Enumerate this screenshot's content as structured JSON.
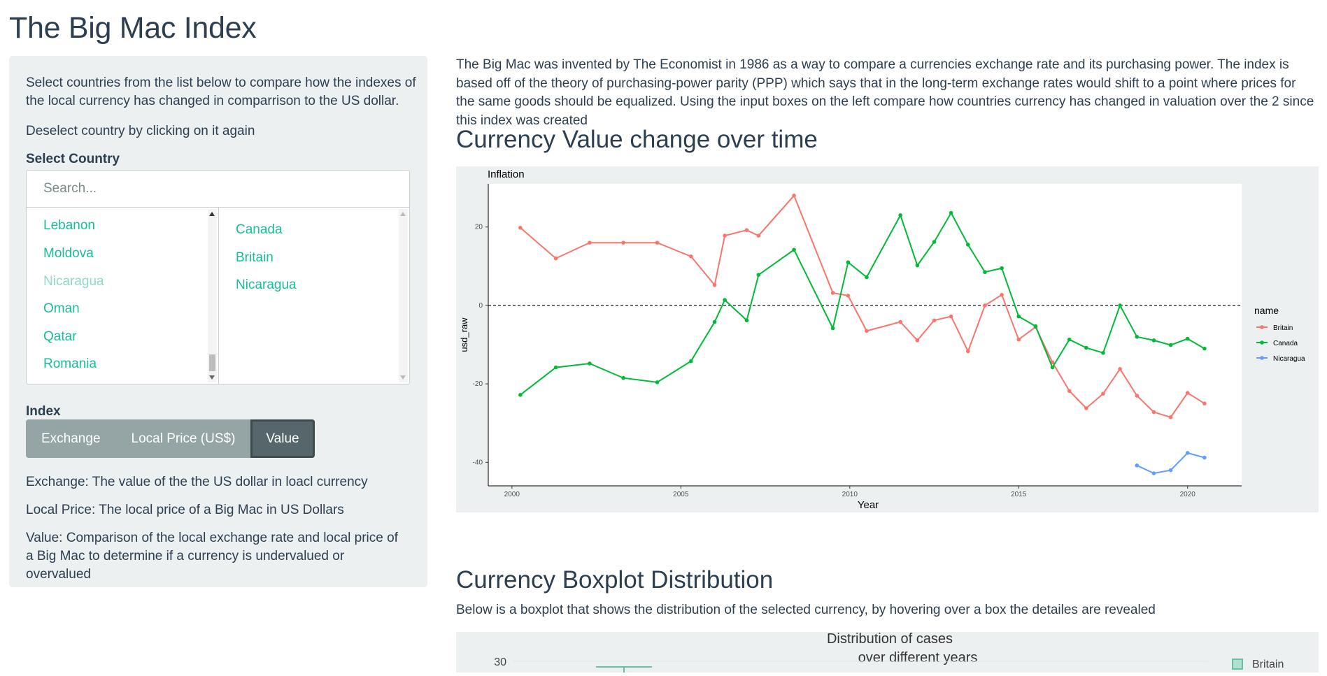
{
  "page": {
    "title": "The Big Mac Index"
  },
  "sidebar": {
    "instructions": "Select countries from the list below to compare how the indexes of the local currency has changed in comparrison to the US dollar.",
    "deselect_hint": "Deselect country by clicking on it again",
    "select_label": "Select Country",
    "search_placeholder": "Search...",
    "available_countries": [
      "Lebanon",
      "Moldova",
      "Nicaragua",
      "Oman",
      "Qatar",
      "Romania"
    ],
    "selected_countries": [
      "Canada",
      "Britain",
      "Nicaragua"
    ],
    "index_label": "Index",
    "index_buttons": [
      "Exchange",
      "Local Price (US$)",
      "Value"
    ],
    "index_selected": "Value",
    "desc_exchange": "Exchange: The value of the the US dollar in loacl currency",
    "desc_local_price": "Local Price: The local price of a Big Mac in US Dollars",
    "desc_value": "Value: Comparison of the local exchange rate and local price of a Big Mac to determine if a currency is undervalued or overvalued"
  },
  "main": {
    "intro": "The Big Mac was invented by The Economist in 1986 as a way to compare a currencies exchange rate and its purchasing power. The index is based off of the theory of purchasing-power parity (PPP) which says that in the long-term exchange rates would shift to a point where prices for the same goods should be equalized. Using the input boxes on the left compare how countries currency has changed in valuation over the 2 since this index was created",
    "line_heading": "Currency Value change over time",
    "boxplot_heading": "Currency Boxplot Distribution",
    "boxplot_desc": "Below is a boxplot that shows the distribution of the selected currency, by hovering over a box the detailes are revealed"
  },
  "chart_data": [
    {
      "type": "line",
      "title": "Inflation",
      "xlabel": "Year",
      "ylabel": "usd_raw",
      "xlim": [
        1999.3,
        2021.6
      ],
      "ylim": [
        -46,
        31
      ],
      "xticks": [
        2000,
        2005,
        2010,
        2015,
        2020
      ],
      "yticks": [
        -40,
        -20,
        0,
        20
      ],
      "reference_line": 0,
      "legend_title": "name",
      "legend_position": "right",
      "series": [
        {
          "name": "Britain",
          "color": "#f8766d",
          "x": [
            2000.25,
            2001.3,
            2002.3,
            2003.3,
            2004.3,
            2005.3,
            2006.0,
            2006.3,
            2006.95,
            2007.3,
            2008.35,
            2009.5,
            2009.95,
            2010.5,
            2011.5,
            2012.0,
            2012.5,
            2013.0,
            2013.5,
            2014.0,
            2014.5,
            2015.0,
            2015.5,
            2016.0,
            2016.5,
            2017.0,
            2017.5,
            2018.0,
            2018.5,
            2019.0,
            2019.5,
            2020.0,
            2020.5
          ],
          "values": [
            19.8,
            12.0,
            16.0,
            16.0,
            16.0,
            12.5,
            5.2,
            17.8,
            19.2,
            17.8,
            28.0,
            3.2,
            2.5,
            -6.5,
            -4.2,
            -8.9,
            -3.8,
            -2.8,
            -11.7,
            0.0,
            2.7,
            -8.7,
            -5.5,
            -14.5,
            -21.8,
            -26.2,
            -22.5,
            -16.2,
            -23.0,
            -27.2,
            -28.5,
            -22.3,
            -25.0
          ]
        },
        {
          "name": "Canada",
          "color": "#00ba38",
          "x": [
            2000.25,
            2001.3,
            2002.3,
            2003.3,
            2004.3,
            2005.3,
            2006.0,
            2006.3,
            2006.95,
            2007.3,
            2008.35,
            2009.5,
            2009.95,
            2010.5,
            2011.5,
            2012.0,
            2012.5,
            2013.0,
            2013.5,
            2014.0,
            2014.5,
            2015.0,
            2015.5,
            2016.0,
            2016.5,
            2017.0,
            2017.5,
            2018.0,
            2018.5,
            2019.0,
            2019.5,
            2020.0,
            2020.5
          ],
          "values": [
            -22.8,
            -15.8,
            -14.8,
            -18.5,
            -19.6,
            -14.2,
            -4.2,
            1.4,
            -3.8,
            7.8,
            14.2,
            -5.8,
            11.0,
            7.2,
            23.0,
            10.2,
            16.2,
            23.6,
            15.5,
            8.5,
            9.5,
            -2.8,
            -5.3,
            -15.8,
            -8.7,
            -10.8,
            -12.1,
            0.0,
            -8.0,
            -8.9,
            -10.1,
            -8.5,
            -11.0
          ]
        },
        {
          "name": "Nicaragua",
          "color": "#619cff",
          "x": [
            2018.5,
            2019.0,
            2019.5,
            2020.0,
            2020.5
          ],
          "values": [
            -40.8,
            -42.8,
            -42.0,
            -37.6,
            -38.8
          ]
        }
      ]
    },
    {
      "type": "box",
      "title": "Distribution of cases over different years",
      "title_lines": [
        "Distribution of cases",
        "over different years"
      ],
      "yticks_visible": [
        30
      ],
      "series": [
        {
          "name": "Britain",
          "color": "#66c2a5"
        }
      ]
    }
  ]
}
